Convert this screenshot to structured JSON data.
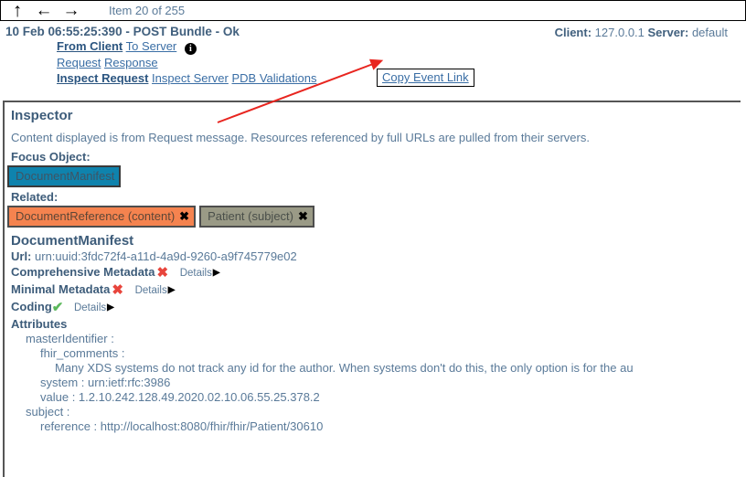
{
  "toolbar": {
    "up_icon": "↑",
    "back_icon": "←",
    "forward_icon": "→",
    "item_counter": "Item 20 of 255"
  },
  "event": {
    "title": "10 Feb 06:55:25:390 - POST Bundle - Ok",
    "client_label": "Client:",
    "client_value": "127.0.0.1",
    "server_label": "Server:",
    "server_value": "default",
    "row1": {
      "from_client": "From Client",
      "to_server": "To Server",
      "info_icon": "i"
    },
    "row2": {
      "request": "Request",
      "response": "Response"
    },
    "row3": {
      "inspect_request": "Inspect Request",
      "inspect_server": "Inspect Server",
      "pdb_validations": "PDB Validations"
    },
    "copy_event_link": "Copy Event Link"
  },
  "inspector": {
    "title": "Inspector",
    "description": "Content displayed is from Request message. Resources referenced by full URLs are pulled from their servers.",
    "focus_label": "Focus Object:",
    "focus_chip": "DocumentManifest",
    "related_label": "Related:",
    "related_chips": [
      {
        "label": "DocumentReference (content)",
        "icon": "✖",
        "style": "orange"
      },
      {
        "label": "Patient (subject)",
        "icon": "✖",
        "style": "olive"
      }
    ]
  },
  "resource": {
    "name": "DocumentManifest",
    "url_label": "Url:",
    "url_value": "urn:uuid:3fdc72f4-a11d-4a9d-9260-a9f745779e02",
    "checks": [
      {
        "label": "Comprehensive Metadata",
        "status": "fail",
        "status_icon": "✖",
        "details_label": "Details",
        "triangle": "▶"
      },
      {
        "label": "Minimal Metadata",
        "status": "fail",
        "status_icon": "✖",
        "details_label": "Details",
        "triangle": "▶"
      },
      {
        "label": "Coding",
        "status": "pass",
        "status_icon": "✔",
        "details_label": "Details",
        "triangle": "▶"
      }
    ],
    "attributes_label": "Attributes",
    "attributes": [
      {
        "indent": 1,
        "text": "masterIdentifier :"
      },
      {
        "indent": 2,
        "text": "fhir_comments :"
      },
      {
        "indent": 3,
        "text": "Many XDS systems do not track any id for the author. When systems don't do this, the only option is for the au"
      },
      {
        "indent": 2,
        "text": "system : urn:ietf:rfc:3986"
      },
      {
        "indent": 2,
        "text": "value : 1.2.10.242.128.49.2020.02.10.06.55.25.378.2"
      },
      {
        "indent": 1,
        "text": "subject :"
      },
      {
        "indent": 2,
        "text": "reference : http://localhost:8080/fhir/fhir/Patient/30610"
      }
    ]
  },
  "annotation": {
    "arrow_color": "#e8251f"
  }
}
